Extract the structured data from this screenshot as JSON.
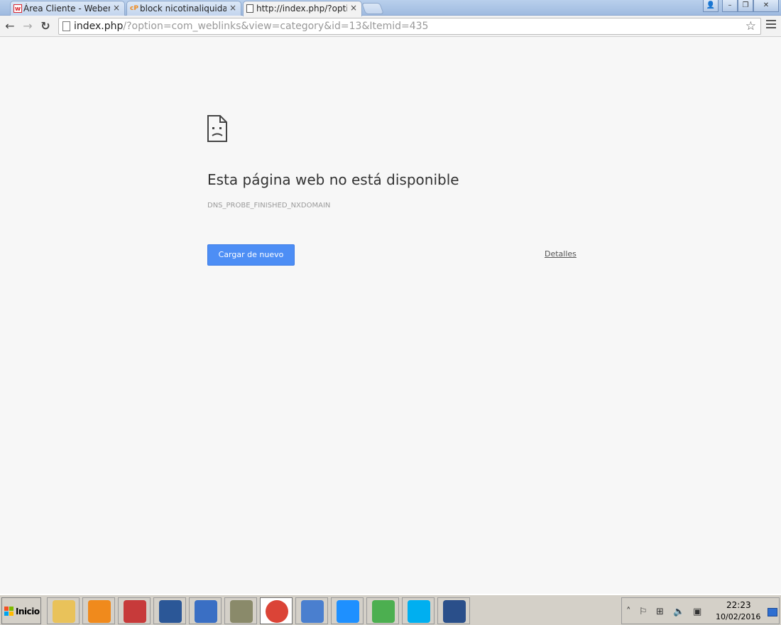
{
  "browser": {
    "tabs": [
      {
        "title": "Área Cliente - Webempresa",
        "favicon": "webempresa-w-icon",
        "close": "×"
      },
      {
        "title": "block nicotinaliquidapara",
        "favicon": "cpanel-icon",
        "close": "×"
      },
      {
        "title": "http://index.php/?option=com_weblinks",
        "favicon": "page-icon",
        "close": "×",
        "active": true
      }
    ],
    "favicon_text": {
      "w": "w",
      "cp": "cP"
    },
    "window_buttons": {
      "user": "👤",
      "minimize": "–",
      "restore": "❐",
      "close": "✕"
    },
    "nav": {
      "back": "←",
      "forward": "→",
      "reload": "↻"
    },
    "url": {
      "host": "index.php",
      "rest": "/?option=com_weblinks&view=category&id=13&Itemid=435"
    },
    "bookmark_star": "☆"
  },
  "error_page": {
    "title": "Esta página web no está disponible",
    "code": "DNS_PROBE_FINISHED_NXDOMAIN",
    "reload_button": "Cargar de nuevo",
    "details_link": "Detalles"
  },
  "taskbar": {
    "start_label": "Inicio",
    "apps": [
      {
        "name": "explorer-folder-icon",
        "color": "#e9c25a"
      },
      {
        "name": "media-player-icon",
        "color": "#f08a1c"
      },
      {
        "name": "scissors-icon",
        "color": "#c73a3a"
      },
      {
        "name": "word-icon",
        "color": "#2b5797"
      },
      {
        "name": "remote-desktop-icon",
        "color": "#3a6fc4"
      },
      {
        "name": "camera-icon",
        "color": "#8a8a6a"
      },
      {
        "name": "chrome-icon",
        "color": "#db4437",
        "active": true
      },
      {
        "name": "keyboard-icon",
        "color": "#4a7fcf"
      },
      {
        "name": "internet-explorer-icon",
        "color": "#1e90ff"
      },
      {
        "name": "utorrent-icon",
        "color": "#4caf50"
      },
      {
        "name": "skype-icon",
        "color": "#00aff0"
      },
      {
        "name": "network-building-icon",
        "color": "#2a4f8a"
      }
    ],
    "tray": {
      "chevron": "˄",
      "flag": "⚐",
      "windows": "⊞",
      "volume": "🔈",
      "network": "▣",
      "time": "22:23",
      "date": "10/02/2016"
    }
  }
}
